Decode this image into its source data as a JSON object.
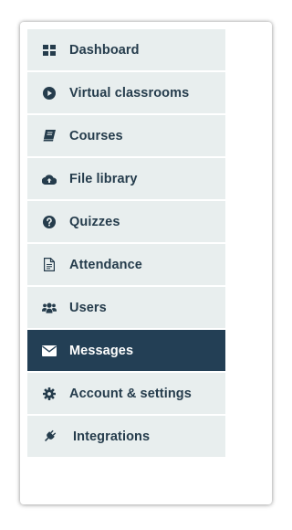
{
  "colors": {
    "item_bg": "#e8eeee",
    "item_text": "#253c4c",
    "active_bg": "#233f55",
    "active_text": "#ffffff"
  },
  "menu": {
    "items": [
      {
        "label": "Dashboard",
        "icon": "dashboard-grid-icon",
        "active": false
      },
      {
        "label": "Virtual classrooms",
        "icon": "play-circle-icon",
        "active": false
      },
      {
        "label": "Courses",
        "icon": "book-icon",
        "active": false
      },
      {
        "label": "File library",
        "icon": "cloud-upload-icon",
        "active": false
      },
      {
        "label": "Quizzes",
        "icon": "question-circle-icon",
        "active": false
      },
      {
        "label": "Attendance",
        "icon": "document-icon",
        "active": false
      },
      {
        "label": "Users",
        "icon": "users-icon",
        "active": false
      },
      {
        "label": "Messages",
        "icon": "envelope-icon",
        "active": true
      },
      {
        "label": "Account & settings",
        "icon": "gear-icon",
        "active": false
      },
      {
        "label": "Integrations",
        "icon": "plug-icon",
        "active": false
      }
    ]
  }
}
